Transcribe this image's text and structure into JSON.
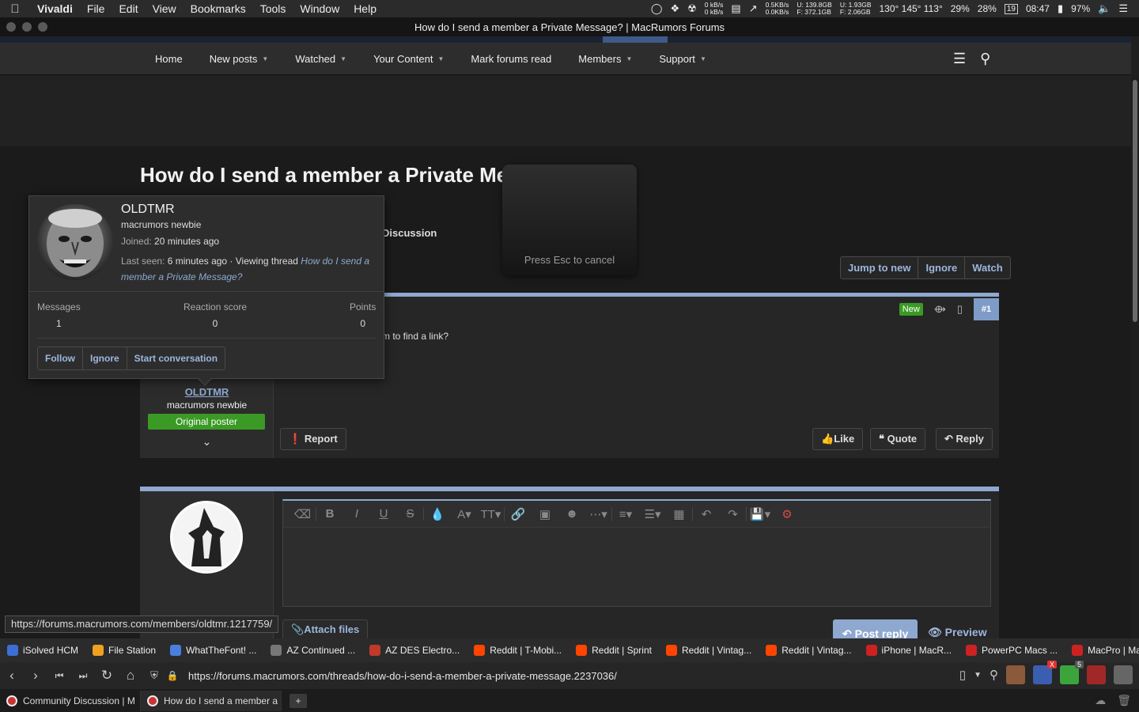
{
  "menubar": {
    "app_name": "Vivaldi",
    "menus": [
      "File",
      "Edit",
      "View",
      "Bookmarks",
      "Tools",
      "Window",
      "Help"
    ],
    "net_up": "0 kB/s",
    "net_down": "0 kB/s",
    "speed_up": "0.5KB/s",
    "speed_down": "0.0KB/s",
    "disk_u": "U: 139.8GB",
    "disk_f": "F: 372.1GB",
    "mem_u": "U:  1.93GB",
    "mem_f": "F:  2.06GB",
    "temps": "130° 145° 113°",
    "cpu1": "29%",
    "cpu2": "28%",
    "date_day": "19",
    "time": "08:47",
    "battery": "97%"
  },
  "window": {
    "title": "How do I send a member a Private Message? | MacRumors Forums"
  },
  "sitenav": {
    "items": [
      {
        "label": "Home",
        "dropdown": false
      },
      {
        "label": "New posts",
        "dropdown": true
      },
      {
        "label": "Watched",
        "dropdown": true
      },
      {
        "label": "Your Content",
        "dropdown": true
      },
      {
        "label": "Mark forums read",
        "dropdown": false
      },
      {
        "label": "Members",
        "dropdown": true
      },
      {
        "label": "Support",
        "dropdown": true
      }
    ]
  },
  "thread": {
    "title": "How do I send a member a Private Message?",
    "forum_partial": "Discussion",
    "actions": [
      "Jump to new",
      "Ignore",
      "Watch"
    ]
  },
  "overlay": {
    "text": "Press Esc to cancel"
  },
  "post": {
    "username": "OLDTMR",
    "user_title": "macrumors newbie",
    "op_badge": "Original poster",
    "body_partial": "m to find a link?",
    "new_label": "New",
    "post_number": "#1",
    "report_label": "Report",
    "like_label": "Like",
    "quote_label": "Quote",
    "reply_label": "Reply"
  },
  "reply_box": {
    "attach_label": "Attach files",
    "post_reply_label": "Post reply",
    "preview_label": "Preview"
  },
  "usercard": {
    "name": "OLDTMR",
    "title": "macrumors newbie",
    "joined_label": "Joined:",
    "joined_value": "20 minutes ago",
    "last_seen_label": "Last seen:",
    "last_seen_value": "6 minutes ago · Viewing thread",
    "last_seen_link": "How do I send a member a Private Message?",
    "stats": [
      {
        "label": "Messages",
        "value": "1"
      },
      {
        "label": "Reaction score",
        "value": "0"
      },
      {
        "label": "Points",
        "value": "0"
      }
    ],
    "buttons": [
      "Follow",
      "Ignore",
      "Start conversation"
    ]
  },
  "status_url": "https://forums.macrumors.com/members/oldtmr.1217759/",
  "bookmarks": [
    {
      "label": "iSolved HCM",
      "color": "#3b6fd6"
    },
    {
      "label": "File Station",
      "color": "#f0a020"
    },
    {
      "label": "WhatTheFont! ...",
      "color": "#4a7fe0"
    },
    {
      "label": "AZ Continued ...",
      "color": "#777777"
    },
    {
      "label": "AZ DES Electro...",
      "color": "#c0392b"
    },
    {
      "label": "Reddit | T-Mobi...",
      "color": "#ff4500"
    },
    {
      "label": "Reddit | Sprint",
      "color": "#ff4500"
    },
    {
      "label": "Reddit | Vintag...",
      "color": "#ff4500"
    },
    {
      "label": "Reddit | Vintag...",
      "color": "#ff4500"
    },
    {
      "label": "iPhone | MacR...",
      "color": "#cc2222"
    },
    {
      "label": "PowerPC Macs ...",
      "color": "#cc2222"
    },
    {
      "label": "MacPro | MacR...",
      "color": "#cc2222"
    }
  ],
  "addressbar": {
    "url": "https://forums.macrumors.com/threads/how-do-i-send-a-member-a-private-message.2237036/"
  },
  "extensions": {
    "badge1": "X",
    "badge2": "5"
  },
  "tabs": [
    {
      "label": "Community Discussion | M",
      "active": false
    },
    {
      "label": "How do I send a member a",
      "active": true
    }
  ],
  "icons": {
    "apple": "apple-icon",
    "search": "search-icon",
    "list": "list-icon"
  }
}
